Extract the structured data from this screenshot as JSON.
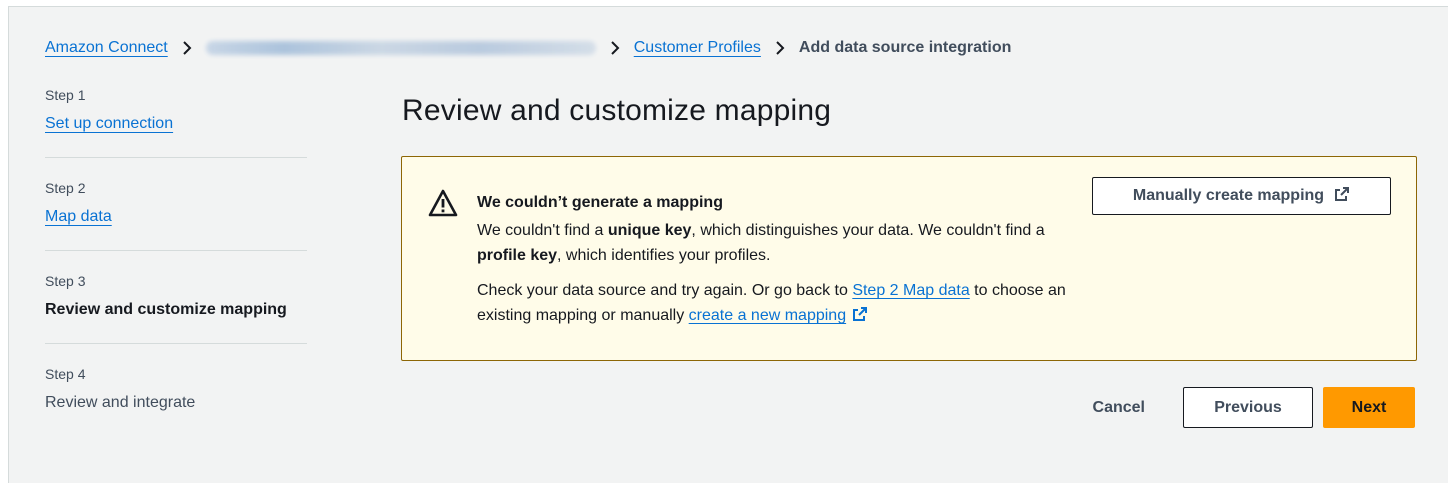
{
  "breadcrumb": {
    "items": [
      {
        "label": "Amazon Connect"
      },
      {
        "label": ""
      },
      {
        "label": "Customer Profiles"
      },
      {
        "label": "Add data source integration"
      }
    ]
  },
  "steps": [
    {
      "number": "Step 1",
      "label": "Set up connection",
      "state": "link"
    },
    {
      "number": "Step 2",
      "label": "Map data",
      "state": "link"
    },
    {
      "number": "Step 3",
      "label": "Review and customize mapping",
      "state": "current"
    },
    {
      "number": "Step 4",
      "label": "Review and integrate",
      "state": "disabled"
    }
  ],
  "page": {
    "title": "Review and customize mapping"
  },
  "alert": {
    "icon": "warning-icon",
    "title": "We couldn’t generate a mapping",
    "line1_a": "We couldn't find a ",
    "line1_b": "unique key",
    "line1_c": ", which distinguishes your data. We couldn't find a ",
    "line1_d": "profile key",
    "line1_e": ", which identifies your profiles.",
    "line2_a": "Check your data source and try again. Or go back to ",
    "line2_link": "Step 2 Map data",
    "line2_b": " to choose an existing mapping or manually ",
    "line2_link2": "create a new mapping",
    "button": "Manually create mapping"
  },
  "actions": {
    "cancel": "Cancel",
    "previous": "Previous",
    "next": "Next"
  },
  "colors": {
    "link": "#0972d3",
    "primary": "#ff9900",
    "warning_bg": "#fffce9",
    "warning_border": "#8d6605"
  }
}
